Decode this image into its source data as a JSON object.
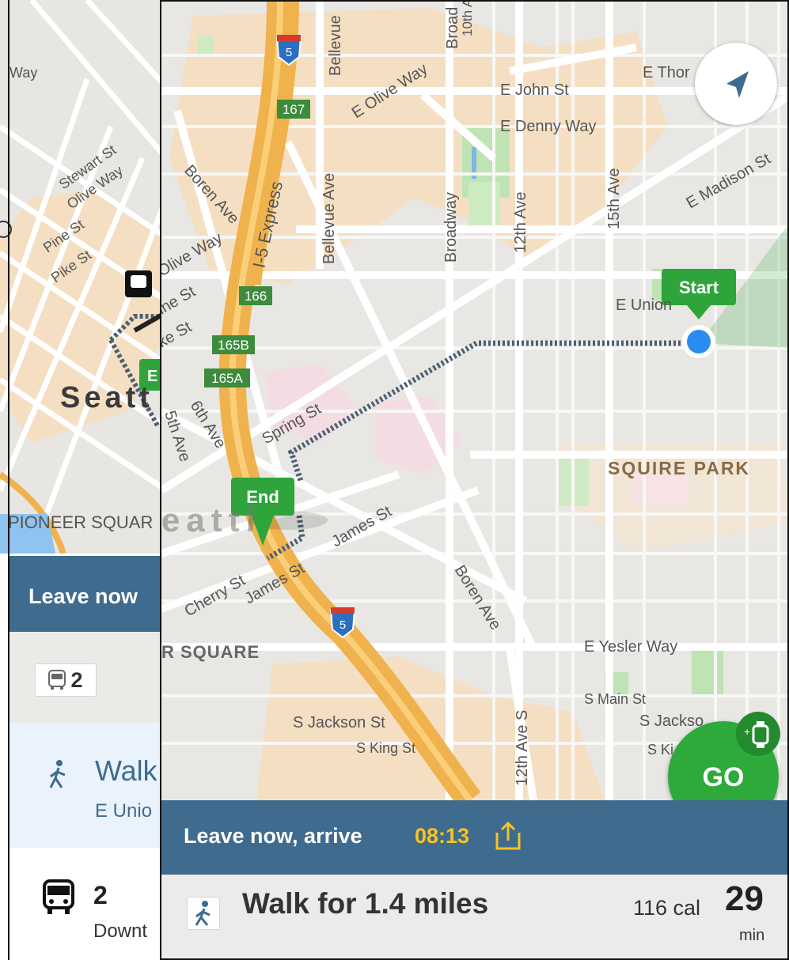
{
  "back_screen": {
    "map": {
      "labels": [
        "Way",
        "Stewart St",
        "Olive Way",
        "Pine St",
        "Pike St",
        "Seatt",
        "PIONEER SQUAR"
      ],
      "end_marker_fragment": "E"
    },
    "leave_bar": {
      "label": "Leave now"
    },
    "route_chip": {
      "icon": "bus-icon",
      "count": "2"
    },
    "walk_row": {
      "icon": "walking-person-icon",
      "title": "Walk",
      "subtitle": "E Unio"
    },
    "bus_row": {
      "icon": "bus-icon",
      "number": "2",
      "subtitle": "Downt"
    }
  },
  "front_screen": {
    "map": {
      "street_labels": [
        "Bellevue",
        "Broad",
        "10th A",
        "E Olive Way",
        "E John St",
        "E Thor",
        "E Denny Way",
        "Boren Ave",
        "I-5 Express",
        "Bellevue Ave",
        "Broadway",
        "12th Ave",
        "15th Ave",
        "E Madison St",
        "Olive Way",
        "ine St",
        "ke St",
        "E Union",
        "Spring St",
        "6th Ave",
        "5th Ave",
        "James St",
        "Cherry St",
        "James St",
        "Boren Ave",
        "E Yesler Way",
        "S Main St",
        "S Jackson St",
        "S King St",
        "12th Ave S",
        "S Jackso",
        "S Ki"
      ],
      "district_labels": [
        "SQUIRE PARK",
        "eattl",
        "R SQUARE"
      ],
      "highway_shields": [
        "5",
        "5"
      ],
      "exit_badges": [
        "167",
        "166",
        "165B",
        "165A"
      ],
      "start_marker": "Start",
      "end_marker": "End"
    },
    "locate_button": {
      "icon": "navigation-arrow-icon"
    },
    "go_button": {
      "label": "GO",
      "badge_icon": "add-watch-icon"
    },
    "leave_bar": {
      "label": "Leave now, arrive",
      "time": "08:13",
      "share_icon": "share-icon"
    },
    "walk_summary": {
      "icon": "walking-person-icon",
      "title": "Walk for 1.4 miles",
      "calories": "116 cal",
      "minutes": "29",
      "unit": "min"
    }
  },
  "colors": {
    "header_blue": "#3f6b8e",
    "arrive_time": "#f6c423",
    "go_green": "#2eaa3b",
    "marker_green": "#2ea43a",
    "location_blue": "#2a8cf0",
    "route_dots": "#4d6073"
  }
}
